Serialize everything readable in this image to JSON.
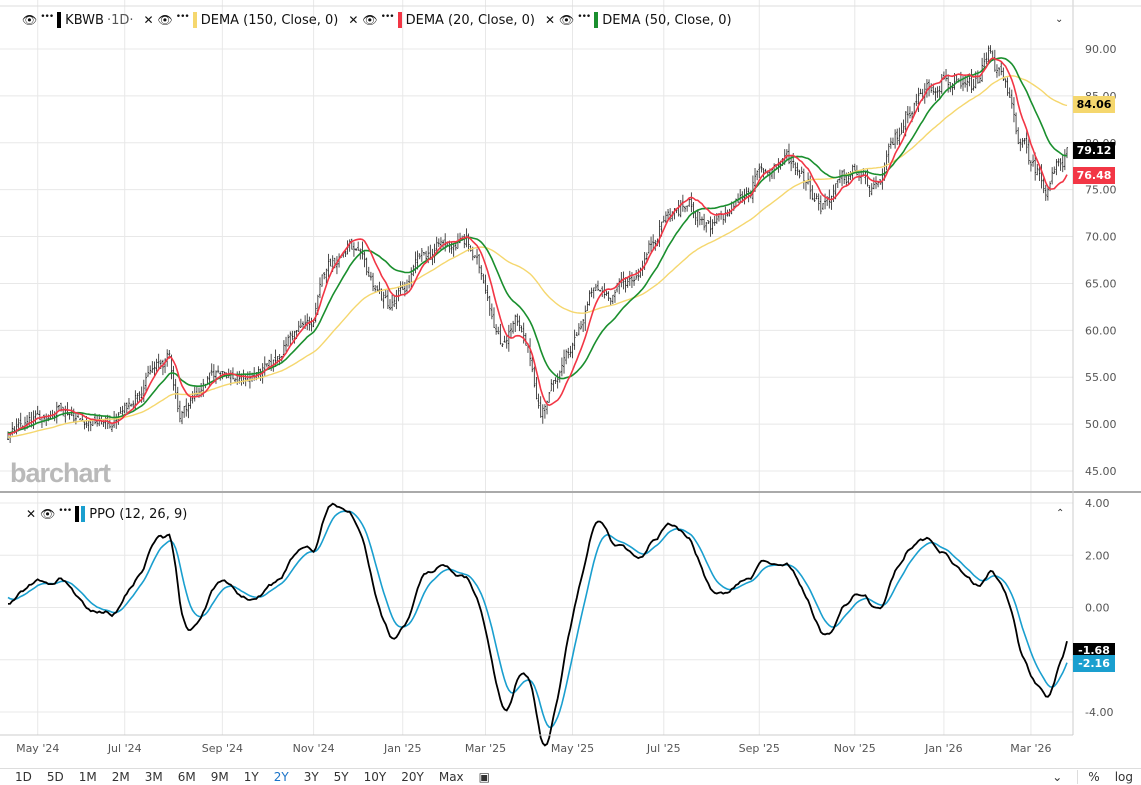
{
  "legend": {
    "symbol": "KBWB",
    "timeframe": "·1D·",
    "indicators": [
      {
        "label": "DEMA (150, Close, 0)",
        "color": "#f5d76e"
      },
      {
        "label": "DEMA (20, Close, 0)",
        "color": "#f23645"
      },
      {
        "label": "DEMA (50, Close, 0)",
        "color": "#1a8f2e"
      }
    ],
    "ppo_label": "PPO (12, 26, 9)",
    "ppo_colors": [
      "#000000",
      "#1a9fcf"
    ]
  },
  "price_axis": {
    "ticks": [
      "90.00",
      "85.00",
      "80.00",
      "75.00",
      "70.00",
      "65.00",
      "60.00",
      "55.00",
      "50.00",
      "45.00"
    ],
    "min": 45,
    "max": 90
  },
  "ppo_axis": {
    "ticks": [
      "4.00",
      "2.00",
      "0.00",
      "-4.00"
    ],
    "min": -4,
    "max": 4
  },
  "last_values": {
    "dema150": "84.06",
    "close": "79.12",
    "dema20": "76.48",
    "ppo": "-1.68",
    "signal": "-2.16"
  },
  "chart_data": {
    "type": "ohlc",
    "days": 500,
    "close_anchors": [
      [
        0,
        49
      ],
      [
        14,
        50.5
      ],
      [
        25,
        52
      ],
      [
        34,
        50.5
      ],
      [
        48,
        50
      ],
      [
        55,
        51.5
      ],
      [
        67,
        55.5
      ],
      [
        76,
        57
      ],
      [
        81,
        51
      ],
      [
        91,
        54
      ],
      [
        101,
        56
      ],
      [
        109,
        54.5
      ],
      [
        124,
        56
      ],
      [
        133,
        59.5
      ],
      [
        144,
        61
      ],
      [
        150,
        67
      ],
      [
        161,
        69
      ],
      [
        175,
        64
      ],
      [
        180,
        62.5
      ],
      [
        186,
        64
      ],
      [
        194,
        67.5
      ],
      [
        204,
        69
      ],
      [
        216,
        69.5
      ],
      [
        225,
        65
      ],
      [
        232,
        58.5
      ],
      [
        239,
        61
      ],
      [
        246,
        57
      ],
      [
        251,
        51
      ],
      [
        258,
        55
      ],
      [
        266,
        58
      ],
      [
        275,
        64
      ],
      [
        284,
        64
      ],
      [
        296,
        66
      ],
      [
        309,
        72
      ],
      [
        322,
        73.5
      ],
      [
        331,
        70.5
      ],
      [
        343,
        73.5
      ],
      [
        354,
        76.5
      ],
      [
        367,
        78.5
      ],
      [
        374,
        77
      ],
      [
        383,
        73.5
      ],
      [
        399,
        77
      ],
      [
        409,
        74.5
      ],
      [
        416,
        79
      ],
      [
        425,
        84
      ],
      [
        441,
        87.5
      ],
      [
        449,
        85
      ],
      [
        456,
        86
      ],
      [
        463,
        90
      ],
      [
        470,
        85.5
      ],
      [
        477,
        80
      ],
      [
        482,
        78
      ],
      [
        489,
        75.5
      ],
      [
        499,
        79
      ]
    ],
    "x_ticks": [
      {
        "day": 14,
        "label": "May '24"
      },
      {
        "day": 55,
        "label": "Jul '24"
      },
      {
        "day": 101,
        "label": "Sep '24"
      },
      {
        "day": 144,
        "label": "Nov '24"
      },
      {
        "day": 186,
        "label": "Jan '25"
      },
      {
        "day": 225,
        "label": "Mar '25"
      },
      {
        "day": 266,
        "label": "May '25"
      },
      {
        "day": 309,
        "label": "Jul '25"
      },
      {
        "day": 354,
        "label": "Sep '25"
      },
      {
        "day": 399,
        "label": "Nov '25"
      },
      {
        "day": 441,
        "label": "Jan '26"
      },
      {
        "day": 482,
        "label": "Mar '26"
      }
    ]
  },
  "logo": "barchart",
  "toolbar": {
    "ranges": [
      "1D",
      "5D",
      "1M",
      "2M",
      "3M",
      "6M",
      "9M",
      "1Y",
      "2Y",
      "3Y",
      "5Y",
      "10Y",
      "20Y",
      "Max"
    ],
    "active": "2Y",
    "calendar_icon": "calendar-icon",
    "percent": "%",
    "log": "log"
  }
}
